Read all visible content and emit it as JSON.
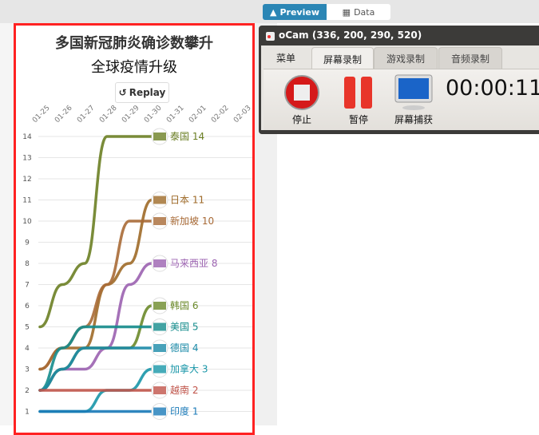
{
  "toolbar": {
    "preview_label": "Preview",
    "data_label": "Data",
    "preview_icon": "area-chart-icon",
    "data_icon": "table-icon"
  },
  "chart": {
    "title": "多国新冠肺炎确诊数攀升",
    "subtitle": "全球疫情升级",
    "replay_label": "Replay",
    "replay_icon": "rotate-left-icon",
    "frame_color": "#ff2222"
  },
  "chart_data": {
    "type": "line",
    "x": [
      "01-25",
      "01-26",
      "01-27",
      "01-28",
      "01-29",
      "01-30",
      "01-31",
      "02-01",
      "02-02",
      "02-03"
    ],
    "yticks": [
      1,
      2,
      3,
      4,
      5,
      6,
      7,
      8,
      9,
      10,
      11,
      12,
      13,
      14
    ],
    "ylim": [
      0,
      14
    ],
    "grid": true,
    "series": [
      {
        "name": "泰国",
        "end_label": "14",
        "color": "#6b7f24",
        "values": [
          5,
          7,
          8,
          14,
          14,
          14
        ]
      },
      {
        "name": "日本",
        "end_label": "11",
        "color": "#9e6a28",
        "values": [
          3,
          4,
          4,
          7,
          8,
          11
        ]
      },
      {
        "name": "新加坡",
        "end_label": "10",
        "color": "#a86a36",
        "values": [
          3,
          4,
          5,
          7,
          10,
          10
        ]
      },
      {
        "name": "马来西亚",
        "end_label": "8",
        "color": "#9b62b0",
        "values": [
          2,
          3,
          3,
          4,
          7,
          8
        ]
      },
      {
        "name": "韩国",
        "end_label": "6",
        "color": "#6b8a2a",
        "values": [
          2,
          3,
          4,
          4,
          4,
          6
        ]
      },
      {
        "name": "美国",
        "end_label": "5",
        "color": "#148c8c",
        "values": [
          2,
          4,
          5,
          5,
          5,
          5
        ]
      },
      {
        "name": "德国",
        "end_label": "4",
        "color": "#1a8aa8",
        "values": [
          2,
          3,
          4,
          4,
          4,
          4
        ]
      },
      {
        "name": "加拿大",
        "end_label": "3",
        "color": "#1896a8",
        "values": [
          1,
          1,
          1,
          2,
          2,
          3
        ]
      },
      {
        "name": "越南",
        "end_label": "2",
        "color": "#c0544a",
        "values": [
          2,
          2,
          2,
          2,
          2,
          2
        ]
      },
      {
        "name": "印度",
        "end_label": "1",
        "color": "#1a7ab8",
        "values": [
          1,
          1,
          1,
          1,
          1,
          1
        ]
      }
    ]
  },
  "ocam": {
    "title": "oCam (336, 200, 290, 520)",
    "tabs": [
      "菜单",
      "屏幕录制",
      "游戏录制",
      "音频录制"
    ],
    "stop_label": "停止",
    "pause_label": "暂停",
    "capture_label": "屏幕捕获",
    "timer": "00:00:11"
  }
}
